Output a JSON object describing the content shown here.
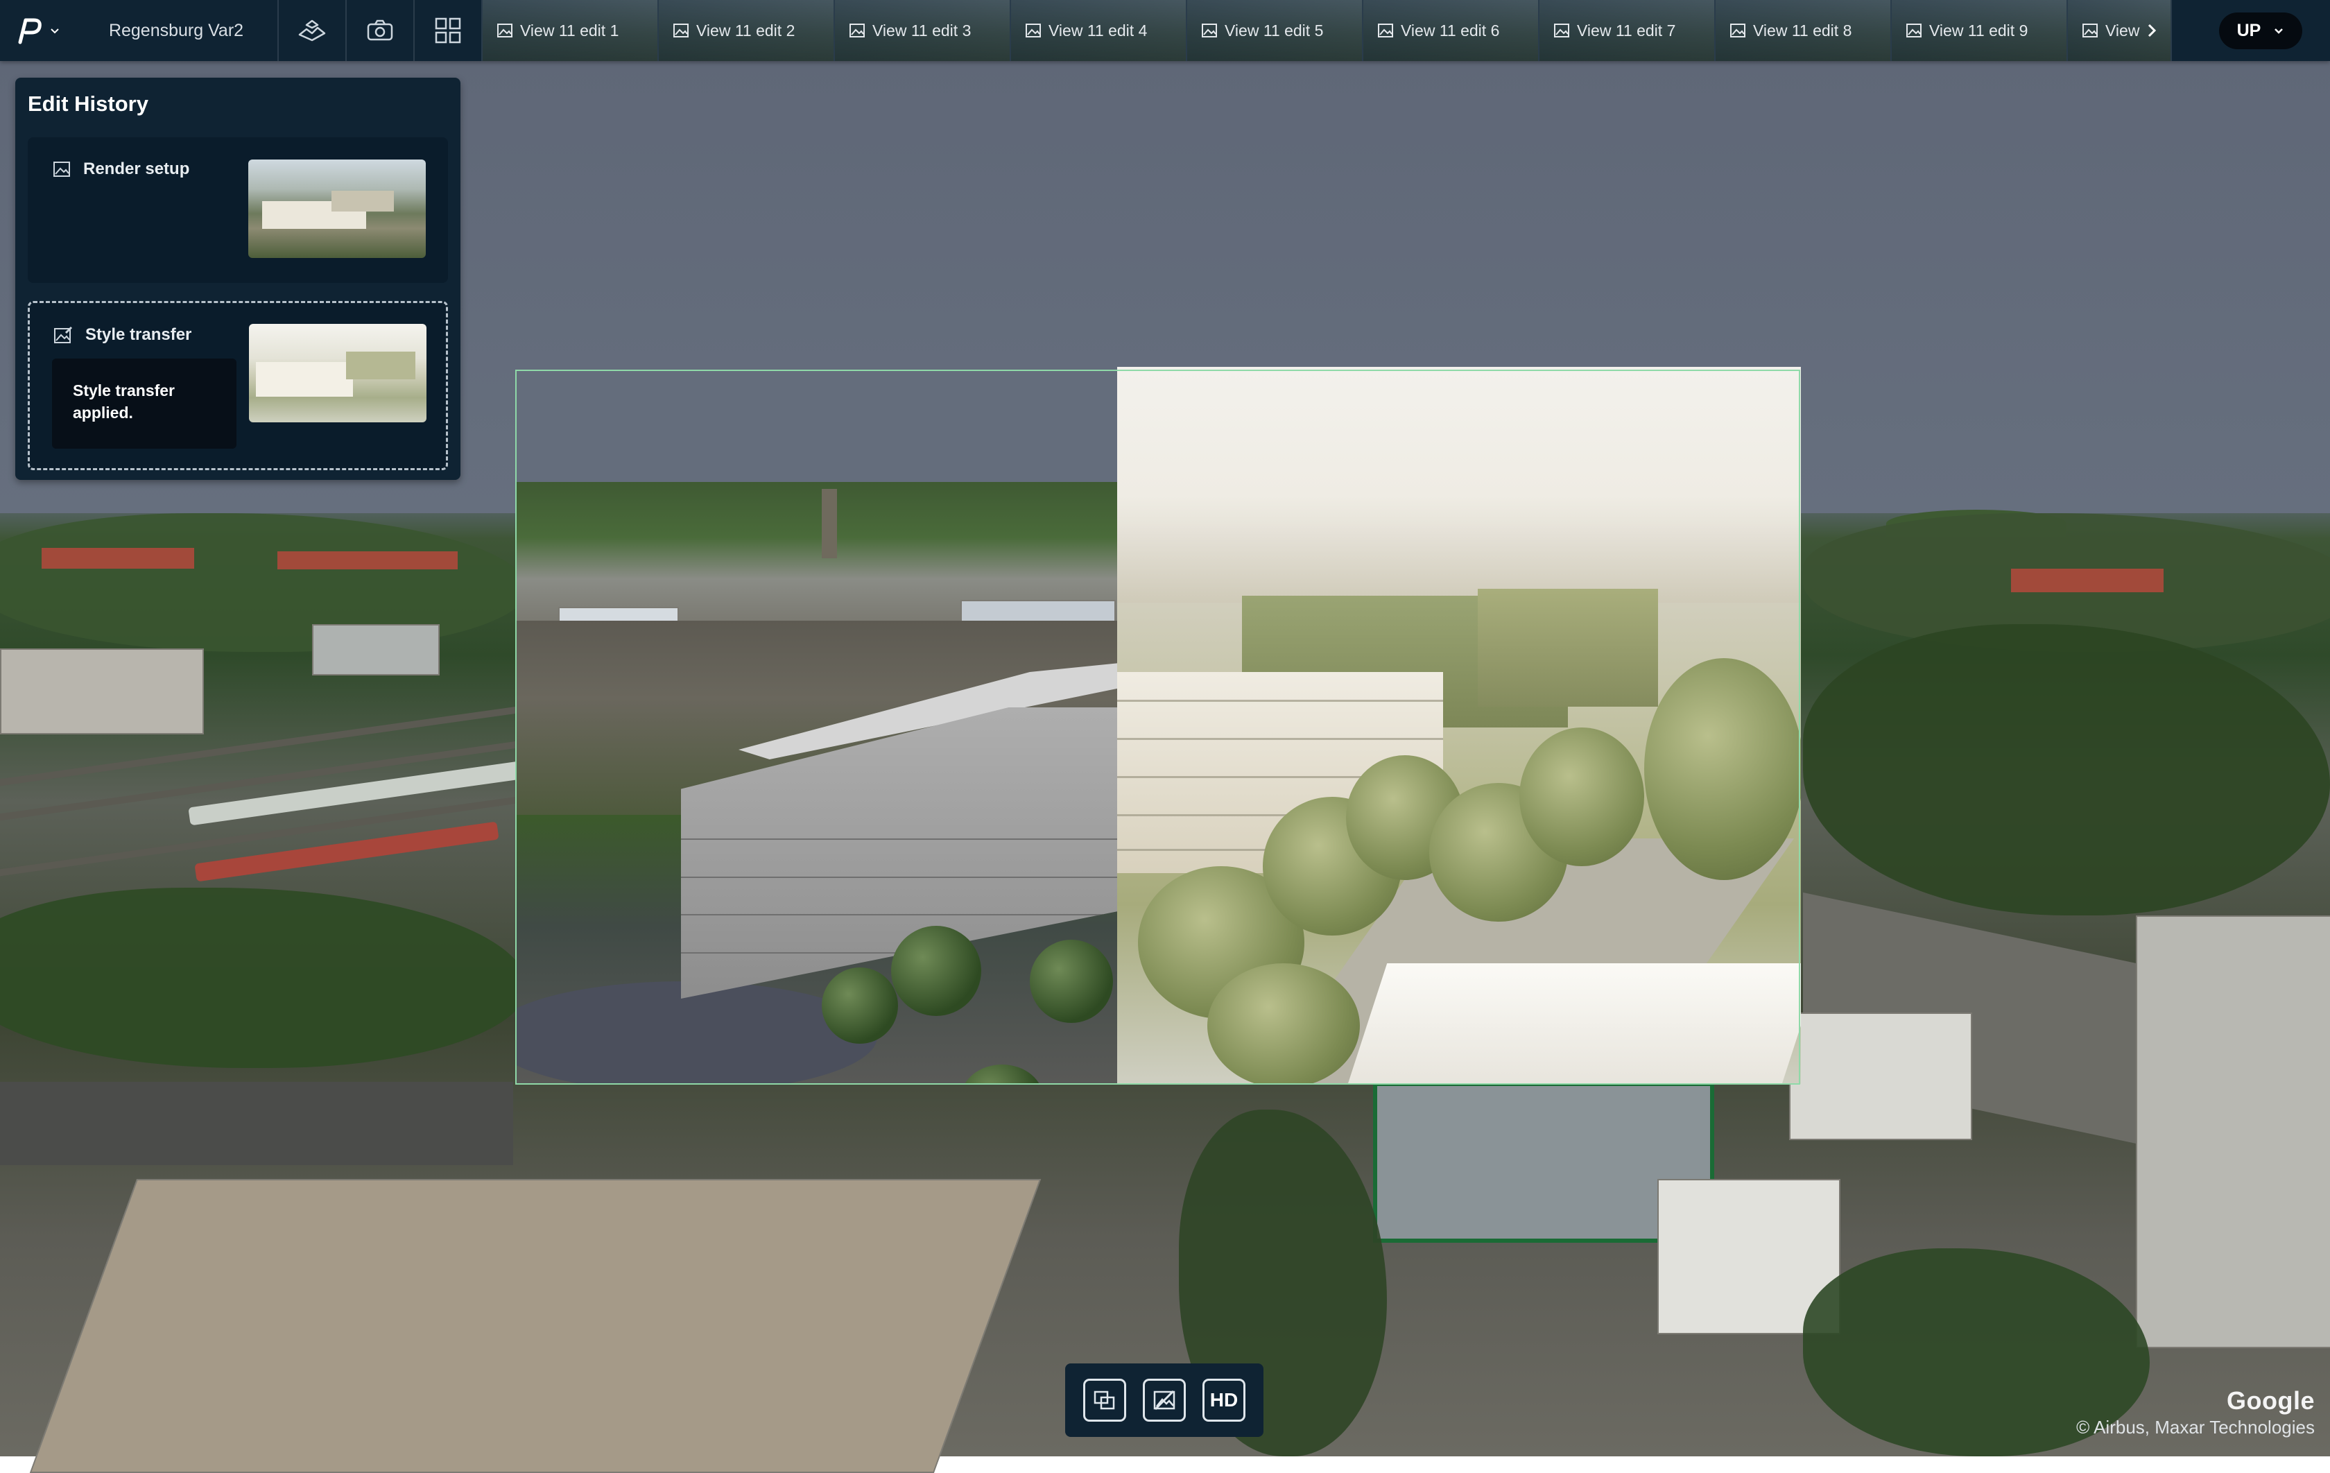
{
  "topbar": {
    "project_name": "Regensburg Var2",
    "views": [
      "View 11 edit 1",
      "View 11 edit 2",
      "View 11 edit 3",
      "View 11 edit 4",
      "View 11 edit 5",
      "View 11 edit 6",
      "View 11 edit 7",
      "View 11 edit 8",
      "View 11 edit 9",
      "View"
    ],
    "user_initials": "UP",
    "icons": [
      "logo-icon",
      "chevron-down-icon",
      "landscape-icon",
      "camera-icon",
      "grid-icon",
      "image-icon",
      "chevron-right-icon"
    ]
  },
  "history": {
    "title": "Edit History",
    "items": [
      {
        "label": "Render setup",
        "icon": "image-icon"
      },
      {
        "label": "Style transfer",
        "icon": "image-edit-icon",
        "message": "Style transfer applied."
      }
    ]
  },
  "bottombar": {
    "hd_label": "HD",
    "icons": [
      "compare-icon",
      "image-off-icon"
    ]
  },
  "attribution": {
    "brand": "Google",
    "copyright": "© Airbus, Maxar Technologies"
  },
  "colors": {
    "panel_bg": "#0f2333",
    "frame_accent": "#8fd9a8"
  }
}
